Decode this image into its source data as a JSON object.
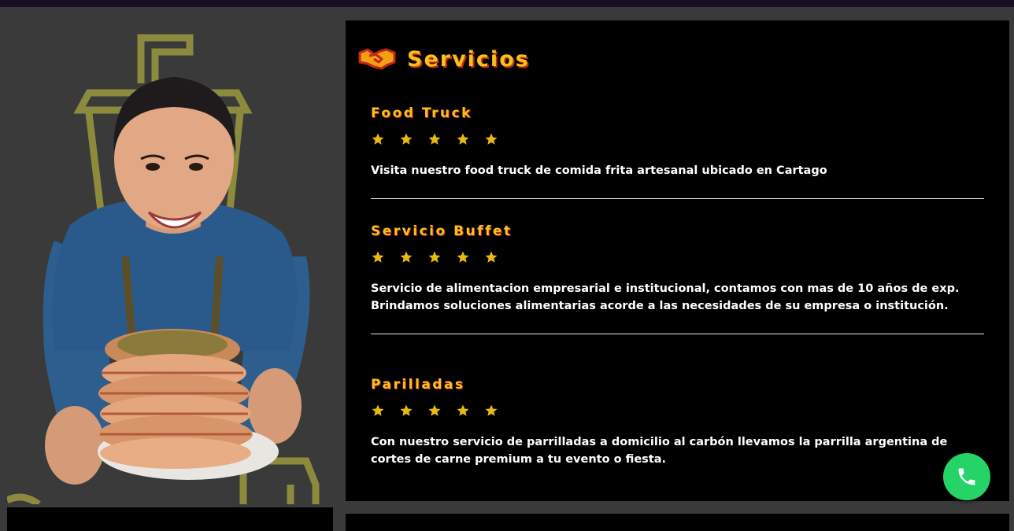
{
  "section": {
    "title": "Servicios",
    "icon": "handshake-icon"
  },
  "services": [
    {
      "name": "Food Truck",
      "rating": 5,
      "description": "Visita nuestro food truck de comida frita artesanal ubicado en Cartago"
    },
    {
      "name": "Servicio Buffet",
      "rating": 5,
      "description": "Servicio de alimentacion empresarial e institucional, contamos con mas de 10 años de exp. Brindamos soluciones alimentarias acorde a las necesidades de su empresa o institución."
    },
    {
      "name": "Parilladas",
      "rating": 5,
      "description": "Con nuestro servicio de parrilladas a domicilio al carbón llevamos la parrilla argentina de cortes de carne premium a tu evento o fiesta."
    }
  ],
  "colors": {
    "accent": "#f7c21a",
    "accent_shadow": "#c3261d",
    "star": "#e9b90e",
    "panel": "#000000",
    "background": "#3a3a3a",
    "whatsapp": "#25d366"
  },
  "floating_button": {
    "icon": "whatsapp-phone-icon"
  }
}
